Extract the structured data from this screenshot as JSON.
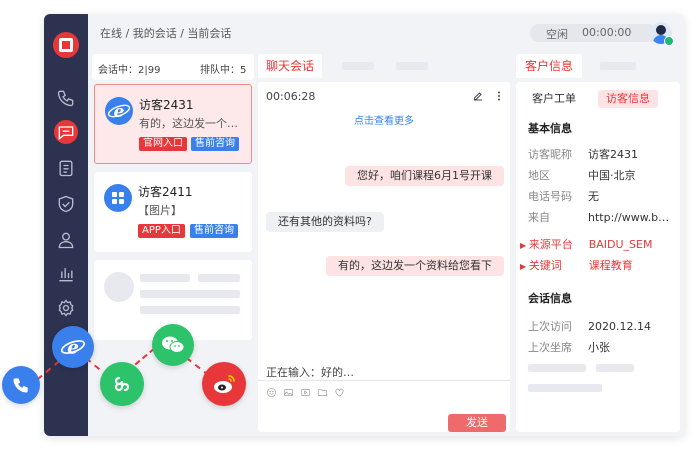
{
  "breadcrumb": "在线 / 我的会话 / 当前会话",
  "status": {
    "state": "空闲",
    "timer": "00:00:00"
  },
  "list": {
    "active_count": "会话中：2|99",
    "queue_count": "排队中：5",
    "cards": [
      {
        "name": "访客2431",
        "msg": "有的，这边发一个…",
        "tags": [
          "官网入口",
          "售前咨询"
        ]
      },
      {
        "name": "访客2411",
        "msg": "【图片】",
        "tags": [
          "APP入口",
          "售前咨询"
        ]
      }
    ]
  },
  "chat": {
    "tab_label": "聊天会话",
    "duration": "00:06:28",
    "load_more": "点击查看更多",
    "messages": [
      {
        "dir": "out",
        "text": "您好，咱们课程6月1号开课"
      },
      {
        "dir": "in",
        "text": "还有其他的资料吗?"
      },
      {
        "dir": "out",
        "text": "有的，这边发一个资料给您看下"
      }
    ],
    "typing": "正在输入：好的…",
    "send_label": "发送"
  },
  "info": {
    "tab_label": "客户信息",
    "subtabs": [
      "客户工单",
      "访客信息"
    ],
    "basic_title": "基本信息",
    "basic": [
      {
        "k": "访客昵称",
        "v": "访客2431"
      },
      {
        "k": "地区",
        "v": "中国·北京"
      },
      {
        "k": "电话号码",
        "v": "无"
      },
      {
        "k": "来自",
        "v": "http://www.b…"
      }
    ],
    "highlight": [
      {
        "k": "来源平台",
        "v": "BAIDU_SEM"
      },
      {
        "k": "关键词",
        "v": "课程教育"
      }
    ],
    "session_title": "会话信息",
    "session": [
      {
        "k": "上次访问",
        "v": "2020.12.14"
      },
      {
        "k": "上次坐席",
        "v": "小张"
      }
    ]
  },
  "colors": {
    "accent": "#e8373a",
    "blue": "#3a80ec",
    "sidebar": "#2d3250",
    "green": "#2cc36b"
  },
  "icons": [
    "phone-icon",
    "chat-icon",
    "clipboard-icon",
    "shield-icon",
    "user-icon",
    "chart-icon",
    "settings-icon",
    "ie-icon",
    "wechat-icon",
    "weibo-icon",
    "mini-program-icon",
    "power-icon",
    "edit-icon",
    "more-icon"
  ]
}
